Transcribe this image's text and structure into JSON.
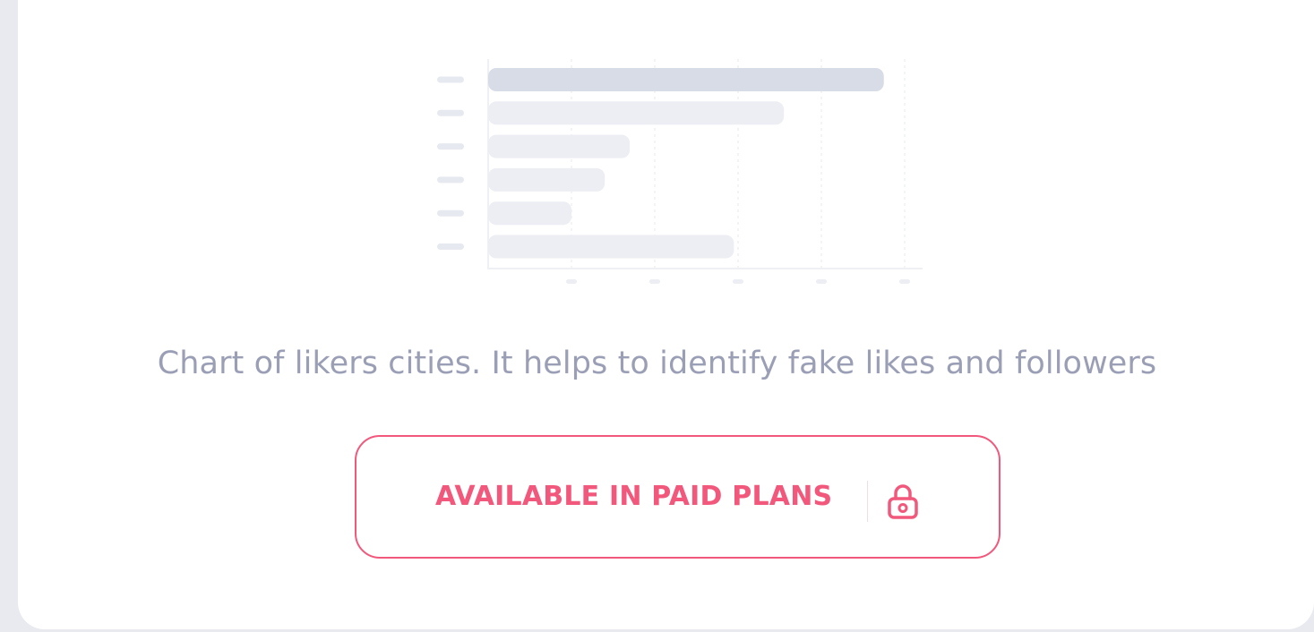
{
  "description": "Chart of likers cities. It helps to identify fake likes and followers",
  "paid_button": {
    "label": "AVAILABLE IN PAID PLANS",
    "icon": "lock-icon"
  },
  "colors": {
    "accent": "#f2587c",
    "text_muted": "#9a9fb6",
    "bar_primary": "#d8dce7",
    "bar_secondary": "#eceef3",
    "card": "#ffffff",
    "background": "#e8eaf0"
  },
  "chart_data": {
    "type": "bar",
    "orientation": "horizontal",
    "placeholder": true,
    "categories": [
      "",
      "",
      "",
      "",
      "",
      ""
    ],
    "values": [
      95,
      71,
      34,
      28,
      20,
      59
    ],
    "xlim": [
      0,
      100
    ],
    "grid": true,
    "title": "",
    "xlabel": "",
    "ylabel": ""
  }
}
